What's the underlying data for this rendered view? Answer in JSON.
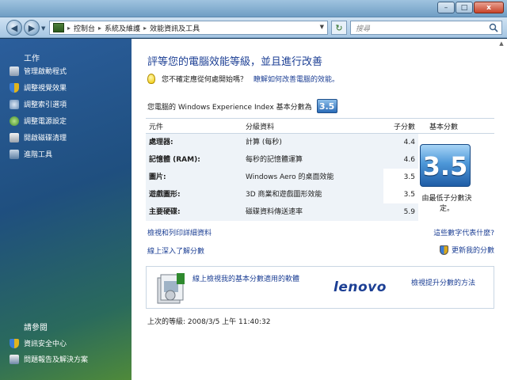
{
  "window": {
    "minimize_glyph": "–",
    "maximize_glyph": "□",
    "close_glyph": "x"
  },
  "nav": {
    "breadcrumbs": [
      "控制台",
      "系統及維護",
      "效能資訊及工具"
    ],
    "search_placeholder": "搜尋"
  },
  "sidebar": {
    "tasks_heading": "工作",
    "tasks": [
      {
        "label": "管理啟動程式",
        "icon": "startup-programs-icon"
      },
      {
        "label": "調整視覺效果",
        "icon": "visual-effects-shield-icon"
      },
      {
        "label": "調整索引選項",
        "icon": "indexing-options-icon"
      },
      {
        "label": "調整電源設定",
        "icon": "power-settings-icon"
      },
      {
        "label": "開啟磁碟清理",
        "icon": "disk-cleanup-icon"
      },
      {
        "label": "進階工具",
        "icon": "advanced-tools-icon"
      }
    ],
    "see_also_heading": "請參閱",
    "see_also": [
      {
        "label": "資訊安全中心",
        "icon": "security-center-icon"
      },
      {
        "label": "問題報告及解決方案",
        "icon": "problem-reports-icon"
      }
    ]
  },
  "main": {
    "title": "評等您的電腦效能等級，並且進行改善",
    "tip_text": "您不確定應從何處開始嗎？",
    "tip_link": "瞭解如何改善電腦的效能。",
    "score_label": "您電腦的 Windows Experience Index 基本分數為",
    "base_score": "3.5",
    "table": {
      "headers": [
        "元件",
        "分級資料",
        "子分數",
        "基本分數"
      ],
      "rows": [
        {
          "component": "處理器:",
          "rating": "計算 (每秒)",
          "subscore": "4.4"
        },
        {
          "component": "記憶體 (RAM):",
          "rating": "每秒的記憶體運算",
          "subscore": "4.6"
        },
        {
          "component": "圖片:",
          "rating": "Windows Aero 的桌面效能",
          "subscore": "3.5"
        },
        {
          "component": "遊戲圖形:",
          "rating": "3D 商業和遊戲圖形效能",
          "subscore": "3.5"
        },
        {
          "component": "主要硬碟:",
          "rating": "磁碟資料傳送速率",
          "subscore": "5.9"
        }
      ],
      "base_caption": "由最低子分數決定。"
    },
    "link_print": "檢視和列印詳細資料",
    "link_meaning": "這些數字代表什麼?",
    "link_learn": "線上深入了解分數",
    "link_update": "更新我的分數",
    "promo": {
      "left_link": "線上檢視我的基本分數適用的軟體",
      "brand": "lenovo",
      "right_link": "檢視提升分數的方法"
    },
    "last_rated": "上次的等級: 2008/3/5 上午 11:40:32"
  }
}
